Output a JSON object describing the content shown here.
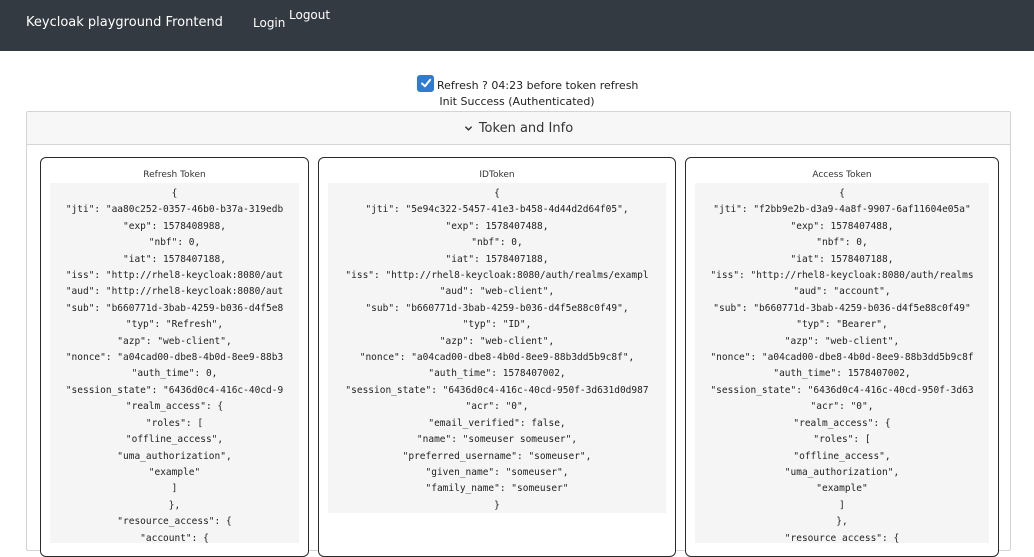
{
  "navbar": {
    "brand": "Keycloak playground Frontend",
    "login": "Login",
    "logout": "Logout"
  },
  "refresh": {
    "checked": true,
    "label": "Refresh ? 04:23 before token refresh"
  },
  "status": "Init Success (Authenticated)",
  "panel": {
    "title": "Token and Info"
  },
  "tokens": [
    {
      "title": "Refresh Token",
      "lines": [
        "{",
        "\"jti\": \"aa80c252-0357-46b0-b37a-319edb",
        "\"exp\": 1578408988,",
        "\"nbf\": 0,",
        "\"iat\": 1578407188,",
        "\"iss\": \"http://rhel8-keycloak:8080/aut",
        "\"aud\": \"http://rhel8-keycloak:8080/aut",
        "\"sub\": \"b660771d-3bab-4259-b036-d4f5e8",
        "\"typ\": \"Refresh\",",
        "\"azp\": \"web-client\",",
        "\"nonce\": \"a04cad00-dbe8-4b0d-8ee9-88b3",
        "\"auth_time\": 0,",
        "\"session_state\": \"6436d0c4-416c-40cd-9",
        "\"realm_access\": {",
        "\"roles\": [",
        "\"offline_access\",",
        "\"uma_authorization\",",
        "\"example\"",
        "]",
        "},",
        "\"resource_access\": {",
        "\"account\": {"
      ]
    },
    {
      "title": "IDToken",
      "lines": [
        "{",
        "\"jti\": \"5e94c322-5457-41e3-b458-4d44d2d64f05\",",
        "\"exp\": 1578407488,",
        "\"nbf\": 0,",
        "\"iat\": 1578407188,",
        "\"iss\": \"http://rhel8-keycloak:8080/auth/realms/exampl",
        "\"aud\": \"web-client\",",
        "\"sub\": \"b660771d-3bab-4259-b036-d4f5e88c0f49\",",
        "\"typ\": \"ID\",",
        "\"azp\": \"web-client\",",
        "\"nonce\": \"a04cad00-dbe8-4b0d-8ee9-88b3dd5b9c8f\",",
        "\"auth_time\": 1578407002,",
        "\"session_state\": \"6436d0c4-416c-40cd-950f-3d631d0d987",
        "\"acr\": \"0\",",
        "\"email_verified\": false,",
        "\"name\": \"someuser someuser\",",
        "\"preferred_username\": \"someuser\",",
        "\"given_name\": \"someuser\",",
        "\"family_name\": \"someuser\"",
        "}"
      ]
    },
    {
      "title": "Access Token",
      "lines": [
        "{",
        "\"jti\": \"f2bb9e2b-d3a9-4a8f-9907-6af11604e05a\"",
        "\"exp\": 1578407488,",
        "\"nbf\": 0,",
        "\"iat\": 1578407188,",
        "\"iss\": \"http://rhel8-keycloak:8080/auth/realms",
        "\"aud\": \"account\",",
        "\"sub\": \"b660771d-3bab-4259-b036-d4f5e88c0f49\"",
        "\"typ\": \"Bearer\",",
        "\"azp\": \"web-client\",",
        "\"nonce\": \"a04cad00-dbe8-4b0d-8ee9-88b3dd5b9c8f",
        "\"auth_time\": 1578407002,",
        "\"session_state\": \"6436d0c4-416c-40cd-950f-3d63",
        "\"acr\": \"0\",",
        "\"realm_access\": {",
        "\"roles\": [",
        "\"offline_access\",",
        "\"uma_authorization\",",
        "\"example\"",
        "]",
        "},",
        "\"resource_access\": {"
      ]
    }
  ],
  "colors": {
    "navbar_bg": "#333a42",
    "checkbox": "#2f7bd1"
  }
}
